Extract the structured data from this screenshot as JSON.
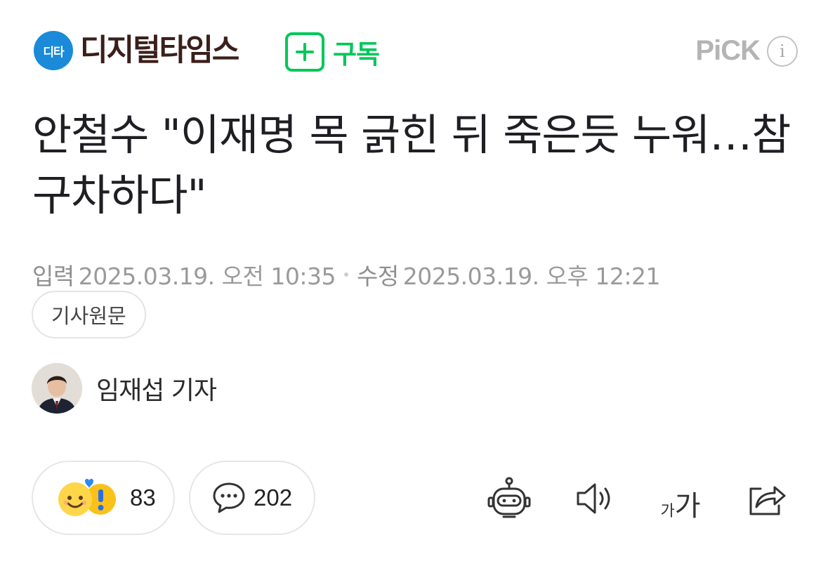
{
  "press": {
    "badge_text": "디타",
    "name": "디지털타임스",
    "brand_color": "#1a8ad9"
  },
  "subscribe": {
    "label": "구독",
    "icon": "plus-icon",
    "color": "#03c75a"
  },
  "pick": {
    "label": "PiCK",
    "info_icon": "info-icon",
    "info_glyph": "i"
  },
  "article": {
    "title": "안철수 \"이재명 목 긁힌 뒤 죽은듯 누워…참 구차하다\"",
    "input_label": "입력",
    "input_time": "2025.03.19. 오전 10:35",
    "modified_label": "수정",
    "modified_time": "2025.03.19. 오후 12:21",
    "original_button": "기사원문"
  },
  "reporter": {
    "name": "임재섭 기자"
  },
  "reactions": {
    "like_count": "83",
    "comment_count": "202"
  },
  "tools": {
    "summary_icon": "robot-icon",
    "tts_icon": "speaker-icon",
    "font_small": "가",
    "font_big": "가",
    "share_icon": "share-icon"
  }
}
